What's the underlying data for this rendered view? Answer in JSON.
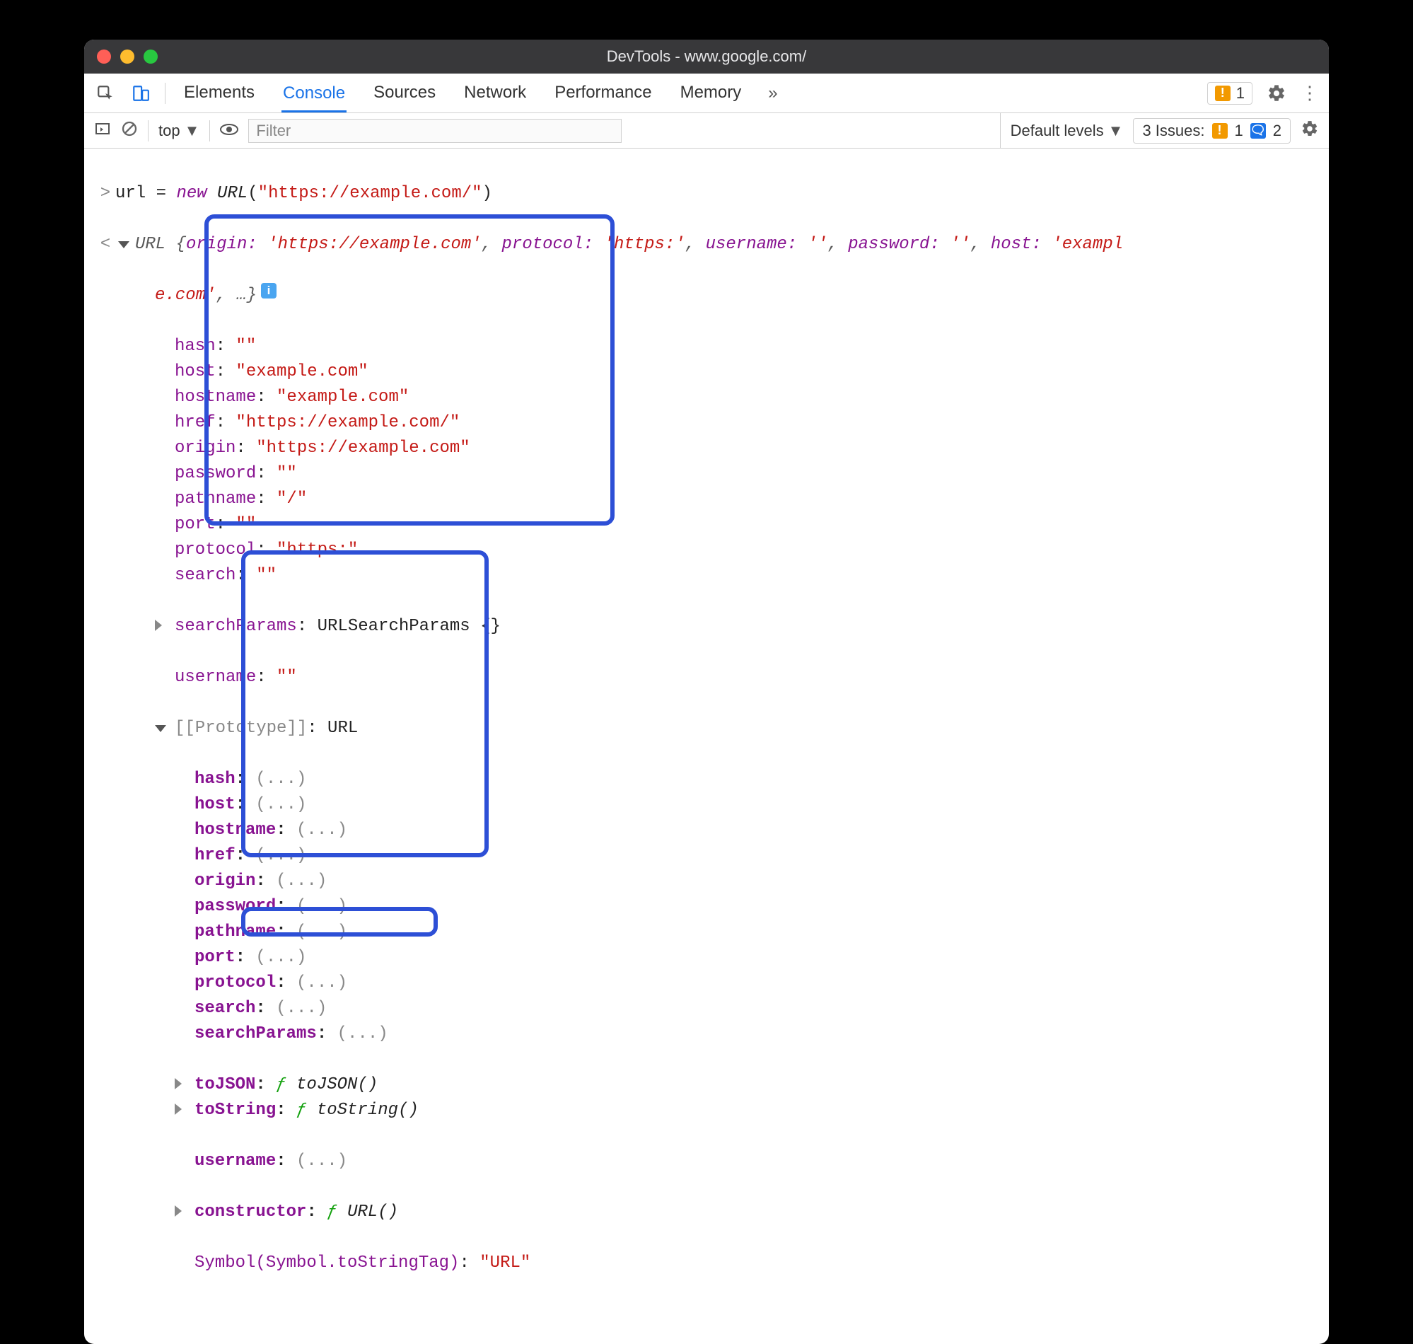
{
  "window": {
    "title": "DevTools - www.google.com/"
  },
  "tabs": {
    "items": [
      "Elements",
      "Console",
      "Sources",
      "Network",
      "Performance",
      "Memory"
    ],
    "active": "Console",
    "overflow": "»"
  },
  "toolbar_right": {
    "warn_count": "1",
    "settings": "⚙",
    "more": "⋮"
  },
  "subbar": {
    "context": "top",
    "filter_placeholder": "Filter",
    "levels": "Default levels",
    "issues_label": "3 Issues:",
    "issues_warn": "1",
    "issues_info": "2"
  },
  "input": {
    "var": "url",
    "eq": " = ",
    "new": "new",
    "cls": " URL",
    "open": "(",
    "arg": "\"https://example.com/\"",
    "close": ")"
  },
  "summary": {
    "cls": "URL ",
    "open": "{",
    "k1": "origin:",
    "v1": "'https://example.com'",
    "k2": "protocol:",
    "v2": "'https:'",
    "k3": "username:",
    "v3": "''",
    "k4": "password:",
    "v4": "''",
    "k5": "host:",
    "v5": "'exampl",
    "cont": "e.com'",
    "rest": ", …}",
    "sep": ", "
  },
  "props": [
    {
      "k": "hash",
      "v": "\"\""
    },
    {
      "k": "host",
      "v": "\"example.com\""
    },
    {
      "k": "hostname",
      "v": "\"example.com\""
    },
    {
      "k": "href",
      "v": "\"https://example.com/\""
    },
    {
      "k": "origin",
      "v": "\"https://example.com\""
    },
    {
      "k": "password",
      "v": "\"\""
    },
    {
      "k": "pathname",
      "v": "\"/\""
    },
    {
      "k": "port",
      "v": "\"\""
    },
    {
      "k": "protocol",
      "v": "\"https:\""
    },
    {
      "k": "search",
      "v": "\"\""
    }
  ],
  "searchParams": {
    "k": "searchParams",
    "v": "URLSearchParams {}"
  },
  "username": {
    "k": "username",
    "v": "\"\""
  },
  "proto": {
    "label": "[[Prototype]]",
    "cls": "URL"
  },
  "proto_props": [
    {
      "k": "hash",
      "v": "(...)"
    },
    {
      "k": "host",
      "v": "(...)"
    },
    {
      "k": "hostname",
      "v": "(...)"
    },
    {
      "k": "href",
      "v": "(...)"
    },
    {
      "k": "origin",
      "v": "(...)"
    },
    {
      "k": "password",
      "v": "(...)"
    },
    {
      "k": "pathname",
      "v": "(...)"
    },
    {
      "k": "port",
      "v": "(...)"
    },
    {
      "k": "protocol",
      "v": "(...)"
    },
    {
      "k": "search",
      "v": "(...)"
    },
    {
      "k": "searchParams",
      "v": "(...)"
    }
  ],
  "proto_fns": [
    {
      "k": "toJSON",
      "f": "ƒ",
      "sig": "toJSON()"
    },
    {
      "k": "toString",
      "f": "ƒ",
      "sig": "toString()"
    }
  ],
  "proto_username": {
    "k": "username",
    "v": "(...)"
  },
  "proto_ctor": {
    "k": "constructor",
    "f": "ƒ",
    "sig": "URL()"
  },
  "proto_symtag": {
    "k": "Symbol(Symbol.toStringTag)",
    "v": "\"URL\""
  }
}
